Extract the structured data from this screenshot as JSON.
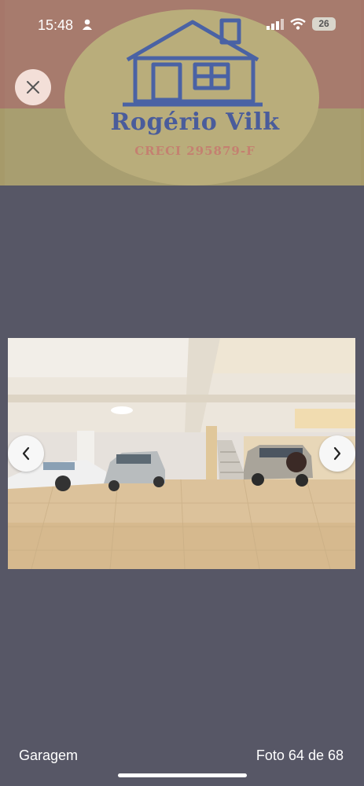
{
  "status_bar": {
    "time": "15:48",
    "battery": "26"
  },
  "watermark": {
    "name": "Rogério Vilk",
    "creci": "CRECI 295879-F"
  },
  "viewer": {
    "caption": "Garagem",
    "counter": "Foto 64 de 68"
  },
  "icons": {
    "close": "close-icon",
    "prev": "chevron-left-icon",
    "next": "chevron-right-icon"
  }
}
